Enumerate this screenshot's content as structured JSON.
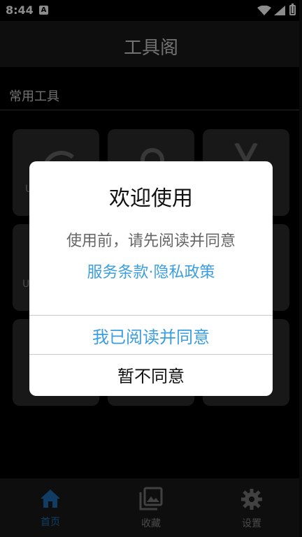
{
  "status_bar": {
    "time": "8:44",
    "notification_icon": "A"
  },
  "app_bar": {
    "title": "工具阁"
  },
  "section": {
    "label": "常用工具"
  },
  "cards": [
    {
      "label": "U"
    },
    {
      "label": ""
    },
    {
      "label": ""
    },
    {
      "label": "U"
    },
    {
      "label": ""
    },
    {
      "label": ""
    },
    {
      "label": ""
    },
    {
      "label": ""
    },
    {
      "label": ""
    }
  ],
  "dialog": {
    "title": "欢迎使用",
    "message": "使用前，请先阅读并同意",
    "terms_link": "服务条款",
    "separator": "·",
    "privacy_link": "隐私政策",
    "agree_button": "我已阅读并同意",
    "decline_button": "暂不同意"
  },
  "bottom_nav": {
    "home": "首页",
    "favorites": "收藏",
    "settings": "设置"
  },
  "colors": {
    "accent": "#3b9ee0",
    "nav_active": "#1f6fb8",
    "nav_inactive": "#888888"
  }
}
